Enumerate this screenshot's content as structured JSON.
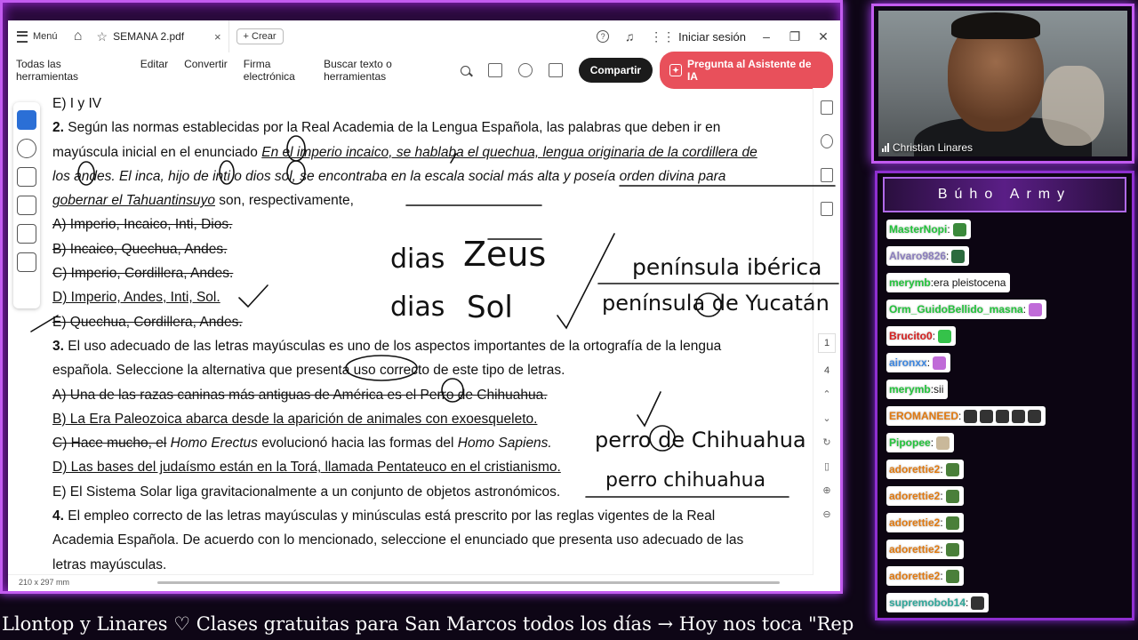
{
  "app": {
    "menu_label": "Menú",
    "tab_title": "SEMANA 2.pdf",
    "new_label": "Crear",
    "signin_label": "Iniciar sesión"
  },
  "toolbar": {
    "items": [
      "Todas las herramientas",
      "Editar",
      "Convertir",
      "Firma electrónica"
    ],
    "search_label": "Buscar texto o herramientas",
    "share_label": "Compartir",
    "ai_label": "Pregunta al Asistente de IA"
  },
  "page_nav": {
    "current": "1",
    "total": "4"
  },
  "page_size_label": "210 x 297 mm",
  "document": {
    "lines": [
      "E) I y IV",
      "2.",
      "Según las normas establecidas por la Real Academia de la Lengua Española, las palabras que deben ir en",
      "mayúscula inicial en el enunciado",
      "En el imperio incaico, se hablaba el quechua, lengua originaria de la cordillera de",
      "los andes. El inca, hijo de inti o dios sol, se encontraba en la escala social más alta y poseía orden divina para",
      "gobernar el Tahuantinsuyo",
      "son, respectivamente,",
      "A) Imperio, Incaico, Inti, Dios.",
      "B) Incaico, Quechua, Andes.",
      "C) Imperio, Cordillera, Andes.",
      "D) Imperio, Andes, Inti, Sol.",
      "E) Quechua, Cordillera, Andes.",
      "3.",
      "El uso adecuado de las letras mayúsculas es uno de los aspectos importantes de la ortografía de la lengua",
      "española. Seleccione la alternativa que presenta uso correcto de este tipo de letras.",
      "A) Una de las razas caninas más antiguas de América es el Perro de Chihuahua.",
      "B) La Era Paleozoica abarca desde la aparición de animales con exoesqueleto.",
      "C) Hace mucho, el",
      "Homo Erectus",
      "evolucionó hacia las formas del",
      "Homo Sapiens.",
      "D) Las bases del judaísmo están en la Torá, llamada Pentateuco en el cristianismo.",
      "E) El Sistema Solar liga gravitacionalmente a un conjunto de objetos astronómicos.",
      "4.",
      "El empleo correcto de las letras mayúsculas y minúsculas está prescrito por las reglas vigentes de la Real",
      "Academia Española. De acuerdo con lo mencionado, seleccione el enunciado que presenta uso adecuado de las",
      "letras mayúsculas."
    ]
  },
  "handwriting": {
    "zeus_dias": "dias",
    "zeus": "Zeus",
    "sol_dias": "dias",
    "sol": "Sol",
    "peninsula1": "península ibérica",
    "peninsula2": "península de Yucatán",
    "perro1": "perro de Chihuahua",
    "perro2": "perro chihuahua"
  },
  "webcam": {
    "name": "Christian Linares"
  },
  "chat": {
    "title": "Búho Army",
    "messages": [
      {
        "user": "MasterNopi",
        "text": "",
        "user_color": "#22c33b",
        "emotes": [
          "#3b8a3b"
        ]
      },
      {
        "user": "Alvaro9826",
        "text": "",
        "user_color": "#8a7dbd",
        "emotes": [
          "#2c6b3e"
        ]
      },
      {
        "user": "merymb",
        "text": "era pleistocena",
        "user_color": "#22c33b",
        "emotes": []
      },
      {
        "user": "Orm_GuidoBellido_masna",
        "text": "",
        "user_color": "#22c33b",
        "emotes": [
          "#c06bd8"
        ]
      },
      {
        "user": "Brucito0",
        "text": "",
        "user_color": "#d41e1e",
        "emotes": [
          "#35c24a"
        ]
      },
      {
        "user": "aironxx",
        "text": "",
        "user_color": "#3c86e0",
        "emotes": [
          "#c06bd8"
        ]
      },
      {
        "user": "merymb",
        "text": "sii",
        "user_color": "#22c33b",
        "emotes": []
      },
      {
        "user": "EROMANEED",
        "text": "",
        "user_color": "#e07a12",
        "emotes": [
          "#333333",
          "#333333",
          "#333333",
          "#333333",
          "#333333"
        ]
      },
      {
        "user": "Pipopee",
        "text": "",
        "user_color": "#22c33b",
        "emotes": [
          "#c9b89a"
        ]
      },
      {
        "user": "adorettie2",
        "text": "",
        "user_color": "#e07a12",
        "emotes": [
          "#4a7f3a"
        ]
      },
      {
        "user": "adorettie2",
        "text": "",
        "user_color": "#e07a12",
        "emotes": [
          "#4a7f3a"
        ]
      },
      {
        "user": "adorettie2",
        "text": "",
        "user_color": "#e07a12",
        "emotes": [
          "#4a7f3a"
        ]
      },
      {
        "user": "adorettie2",
        "text": "",
        "user_color": "#e07a12",
        "emotes": [
          "#4a7f3a"
        ]
      },
      {
        "user": "adorettie2",
        "text": "",
        "user_color": "#e07a12",
        "emotes": [
          "#4a7f3a"
        ]
      },
      {
        "user": "supremobob14",
        "text": "",
        "user_color": "#2fa79a",
        "emotes": [
          "#333333"
        ]
      }
    ]
  },
  "ticker": "Llontop y Linares ♡    Clases gratuitas para San Marcos todos los días  →  Hoy nos toca \"Repas"
}
